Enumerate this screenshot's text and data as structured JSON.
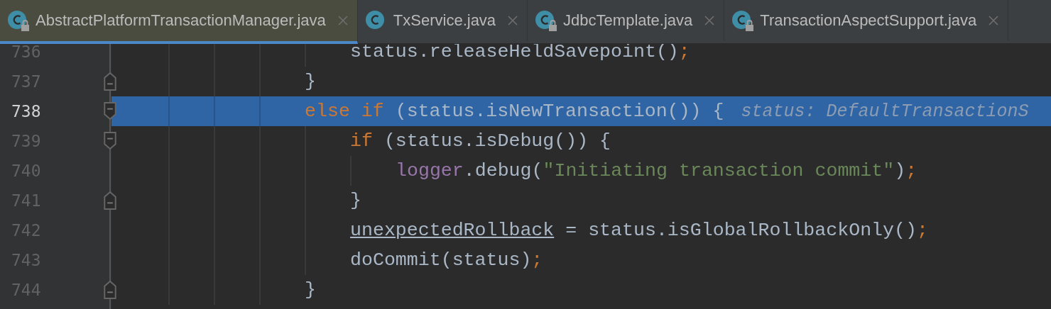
{
  "tabs": [
    {
      "label": "AbstractPlatformTransactionManager.java",
      "selected": true,
      "locked": true
    },
    {
      "label": "TxService.java",
      "selected": false,
      "locked": false
    },
    {
      "label": "JdbcTemplate.java",
      "selected": false,
      "locked": true
    },
    {
      "label": "TransactionAspectSupport.java",
      "selected": false,
      "locked": true
    }
  ],
  "editor": {
    "lines": [
      {
        "number": "736",
        "kind": "body",
        "highlighted": false,
        "fold_start": false,
        "fold_end": false,
        "segments": [
          {
            "kind": "plain",
            "text": "status.releaseHeldSavepoint()"
          },
          {
            "kind": "punct",
            "text": ";"
          }
        ]
      },
      {
        "number": "737",
        "kind": "statement",
        "highlighted": false,
        "fold_start": false,
        "fold_end": true,
        "segments": [
          {
            "kind": "plain",
            "text": "}"
          }
        ]
      },
      {
        "number": "738",
        "kind": "statement",
        "highlighted": true,
        "fold_start": true,
        "fold_end": false,
        "segments": [
          {
            "kind": "keyword",
            "text": "else if"
          },
          {
            "kind": "plain",
            "text": " (status.isNewTransaction()) {"
          },
          {
            "kind": "hint",
            "text": "status: DefaultTransactionS"
          }
        ],
        "children": [
          {
            "number": "739",
            "kind": "statement",
            "highlighted": false,
            "fold_start": true,
            "fold_end": false,
            "segments": [
              {
                "kind": "keyword",
                "text": "if"
              },
              {
                "kind": "plain",
                "text": " (status.isDebug()) {"
              }
            ],
            "children": [
              {
                "number": "740",
                "kind": "statement",
                "highlighted": false,
                "fold_start": false,
                "fold_end": false,
                "segments": [
                  {
                    "kind": "field",
                    "text": "logger"
                  },
                  {
                    "kind": "plain",
                    "text": ".debug("
                  },
                  {
                    "kind": "string",
                    "text": "\"Initiating transaction commit\""
                  },
                  {
                    "kind": "plain",
                    "text": ")"
                  },
                  {
                    "kind": "punct",
                    "text": ";"
                  }
                ]
              }
            ]
          },
          {
            "number": "741",
            "kind": "statement",
            "highlighted": false,
            "fold_start": false,
            "fold_end": true,
            "segments": [
              {
                "kind": "plain",
                "text": "}"
              }
            ]
          },
          {
            "number": "742",
            "kind": "statement",
            "highlighted": false,
            "fold_start": false,
            "fold_end": false,
            "segments": [
              {
                "kind": "reassigned",
                "text": "unexpectedRollback"
              },
              {
                "kind": "plain",
                "text": " = status.isGlobalRollbackOnly()"
              },
              {
                "kind": "punct",
                "text": ";"
              }
            ]
          },
          {
            "number": "743",
            "kind": "statement",
            "highlighted": false,
            "fold_start": false,
            "fold_end": false,
            "segments": [
              {
                "kind": "plain",
                "text": "doCommit(status)"
              },
              {
                "kind": "punct",
                "text": ";"
              }
            ]
          }
        ]
      },
      {
        "number": "744",
        "kind": "statement",
        "highlighted": false,
        "fold_start": false,
        "fold_end": true,
        "segments": [
          {
            "kind": "plain",
            "text": "}"
          }
        ]
      }
    ]
  }
}
